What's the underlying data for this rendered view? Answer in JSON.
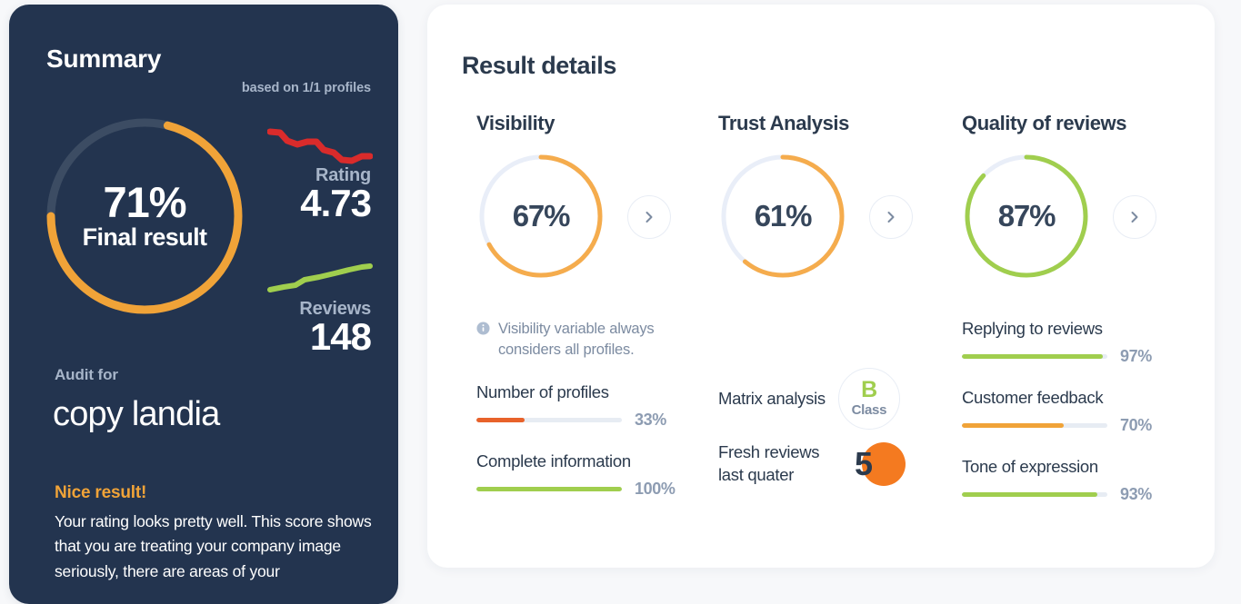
{
  "summary": {
    "title": "Summary",
    "based_on": "based on 1/1 profiles",
    "final_result": {
      "value": "71%",
      "label": "Final result",
      "percent": 71,
      "arc_color": "#f0a338",
      "track_color": "#3c4c63"
    },
    "rating": {
      "label": "Rating",
      "value": "4.73",
      "sparkline_color": "#d92b2b",
      "sparkline_trend": "down"
    },
    "reviews": {
      "label": "Reviews",
      "value": "148",
      "sparkline_color": "#a0ce4e",
      "sparkline_trend": "up"
    },
    "audit_for_label": "Audit for",
    "company_name": "copy landia",
    "verdict_title": "Nice result!",
    "verdict_body": "Your rating looks pretty well. This score shows that you are treating your company image seriously, there are areas of your"
  },
  "results": {
    "title": "Result details",
    "arrow_icon": "chevron-right-icon",
    "columns": [
      {
        "heading": "Visibility",
        "donut": {
          "value": "67%",
          "percent": 67,
          "color": "#f5ac4d"
        },
        "note": {
          "icon": "info-icon",
          "text": "Visibility variable always considers all profiles."
        },
        "metrics": [
          {
            "label": "Number of profiles",
            "value": "33%",
            "percent": 33,
            "color": "#e8622a"
          },
          {
            "label": "Complete information",
            "value": "100%",
            "percent": 100,
            "color": "#a0ce4e"
          }
        ]
      },
      {
        "heading": "Trust Analysis",
        "donut": {
          "value": "61%",
          "percent": 61,
          "color": "#f5ac4d"
        },
        "matrix": {
          "label": "Matrix analysis",
          "class_letter": "B",
          "class_word": "Class",
          "letter_color": "#a0ce4e"
        },
        "fresh": {
          "label": "Fresh reviews last quater",
          "count": "5",
          "badge_color": "#f47a20"
        }
      },
      {
        "heading": "Quality of reviews",
        "donut": {
          "value": "87%",
          "percent": 87,
          "color": "#a0ce4e"
        },
        "metrics": [
          {
            "label": "Replying to reviews",
            "value": "97%",
            "percent": 97,
            "color": "#a0ce4e"
          },
          {
            "label": "Customer feedback",
            "value": "70%",
            "percent": 70,
            "color": "#f0a338"
          },
          {
            "label": "Tone of expression",
            "value": "93%",
            "percent": 93,
            "color": "#a0ce4e"
          }
        ]
      }
    ]
  },
  "chart_data": {
    "type": "pie",
    "title": "Result details",
    "series": [
      {
        "name": "Final result",
        "value": 71,
        "unit": "%"
      },
      {
        "name": "Visibility",
        "value": 67,
        "unit": "%"
      },
      {
        "name": "Trust Analysis",
        "value": 61,
        "unit": "%"
      },
      {
        "name": "Quality of reviews",
        "value": 87,
        "unit": "%"
      },
      {
        "name": "Number of profiles",
        "value": 33,
        "unit": "%"
      },
      {
        "name": "Complete information",
        "value": 100,
        "unit": "%"
      },
      {
        "name": "Replying to reviews",
        "value": 97,
        "unit": "%"
      },
      {
        "name": "Customer feedback",
        "value": 70,
        "unit": "%"
      },
      {
        "name": "Tone of expression",
        "value": 93,
        "unit": "%"
      }
    ],
    "ylim": [
      0,
      100
    ],
    "legend": "none",
    "grid": false
  }
}
